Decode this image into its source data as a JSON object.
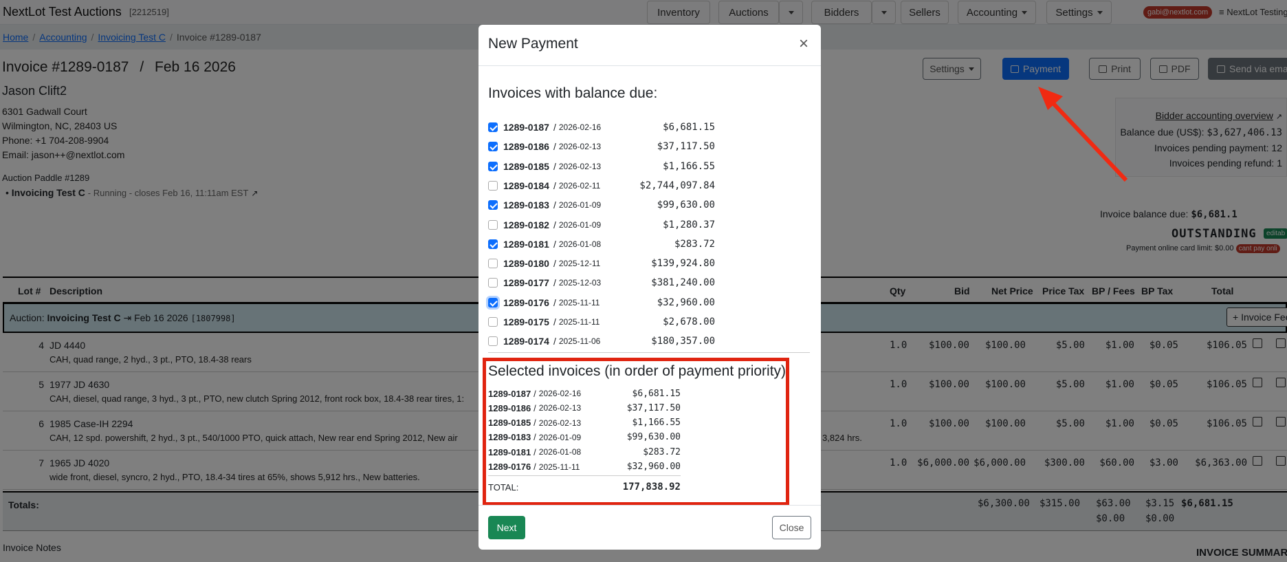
{
  "app": {
    "name": "NextLot Test Auctions",
    "id": "[2212519]"
  },
  "nav": {
    "inventory": "Inventory",
    "auctions": "Auctions",
    "bidders": "Bidders",
    "sellers": "Sellers",
    "accounting": "Accounting",
    "settings": "Settings",
    "user_email": "gabi@nextlot.com",
    "user_org": "≡ NextLot Testing"
  },
  "breadcrumb": {
    "home": "Home",
    "accounting": "Accounting",
    "invoicing": "Invoicing Test C",
    "current": "Invoice #1289-0187"
  },
  "invoice": {
    "number": "Invoice #1289-0187",
    "sep": "/",
    "date": "Feb 16 2026",
    "customer": "Jason Clift2",
    "addr1": "6301 Gadwall Court",
    "addr2": "Wilmington, NC, 28403 US",
    "phone": "Phone: +1 704-208-9904",
    "email": "Email: jason++@nextlot.com",
    "paddle": "Auction Paddle #1289",
    "auction_name": "Invoicing Test C",
    "auction_status": "- Running - closes Feb 16, 11:11am EST"
  },
  "actions": {
    "settings": "Settings",
    "payment": "Payment",
    "print": "Print",
    "pdf": "PDF",
    "send": "Send via email"
  },
  "accounting": {
    "overview": "Bidder accounting overview",
    "balance_label": "Balance due (US$):",
    "balance_value": "$3,627,406.13",
    "pending_payment_label": "Invoices pending payment:",
    "pending_payment_value": "12",
    "pending_refund_label": "Invoices pending refund:",
    "pending_refund_value": "1",
    "invoice_balance_label": "Invoice balance due:",
    "invoice_balance_value": "$6,681.1",
    "status": "OUTSTANDING",
    "editable": "editab",
    "card_limit": "Payment online card limit: $0.00",
    "cant_pay": "cant pay onli"
  },
  "table": {
    "headers": {
      "lot": "Lot #",
      "desc": "Description",
      "qty": "Qty",
      "bid": "Bid",
      "net": "Net Price",
      "ptax": "Price Tax",
      "bp": "BP / Fees",
      "bptax": "BP Tax",
      "total": "Total"
    },
    "auction_row": {
      "label": "Auction:",
      "name": "Invoicing Test C",
      "arrow": "⇥",
      "date": "Feb 16 2026",
      "id": "[1807998]",
      "fee_btn": "+ Invoice Fee"
    },
    "rows": [
      {
        "lot": "4",
        "title": "JD 4440",
        "desc": "CAH, quad range, 2 hyd., 3 pt., PTO, 18.4-38 rears",
        "qty": "1.0",
        "bid": "$100.00",
        "net": "$100.00",
        "ptax": "$5.00",
        "bp": "$1.00",
        "bptax": "$0.05",
        "total": "$106.05"
      },
      {
        "lot": "5",
        "title": "1977 JD 4630",
        "desc": "CAH, diesel, quad range, 3 hyd., 3 pt., PTO, new clutch Spring 2012, front rock box, 18.4-38 rear tires, 1:",
        "qty": "1.0",
        "bid": "$100.00",
        "net": "$100.00",
        "ptax": "$5.00",
        "bp": "$1.00",
        "bptax": "$0.05",
        "total": "$106.05"
      },
      {
        "lot": "6",
        "title": "1985 Case-IH 2294",
        "desc": "CAH, 12 spd. powershift, 2 hyd., 3 pt., 540/1000 PTO, quick attach, New rear end Spring 2012, New air",
        "desc2": "3,824 hrs.",
        "qty": "1.0",
        "bid": "$100.00",
        "net": "$100.00",
        "ptax": "$5.00",
        "bp": "$1.00",
        "bptax": "$0.05",
        "total": "$106.05"
      },
      {
        "lot": "7",
        "title": "1965 JD 4020",
        "desc": "wide front, diesel, syncro, 2 hyd., PTO, 18.4-34 tires at 65%, shows 5,912 hrs., New batteries.",
        "qty": "1.0",
        "bid": "$6,000.00",
        "net": "$6,000.00",
        "ptax": "$300.00",
        "bp": "$60.00",
        "bptax": "$3.00",
        "total": "$6,363.00"
      }
    ],
    "totals": {
      "label": "Totals:",
      "net": "$6,300.00",
      "ptax": "$315.00",
      "bp": "$63.00",
      "bp2": "$0.00",
      "bptax": "$3.15",
      "bptax2": "$0.00",
      "total": "$6,681.15"
    }
  },
  "notes_label": "Invoice Notes",
  "summary_label": "INVOICE SUMMARY",
  "modal": {
    "title": "New Payment",
    "close_x": "×",
    "subtitle": "Invoices with balance due:",
    "invoices": [
      {
        "num": "1289-0187",
        "date": "2026-02-16",
        "amt": "$6,681.15",
        "checked": true
      },
      {
        "num": "1289-0186",
        "date": "2026-02-13",
        "amt": "$37,117.50",
        "checked": true
      },
      {
        "num": "1289-0185",
        "date": "2026-02-13",
        "amt": "$1,166.55",
        "checked": true
      },
      {
        "num": "1289-0184",
        "date": "2026-02-11",
        "amt": "$2,744,097.84",
        "checked": false
      },
      {
        "num": "1289-0183",
        "date": "2026-01-09",
        "amt": "$99,630.00",
        "checked": true
      },
      {
        "num": "1289-0182",
        "date": "2026-01-09",
        "amt": "$1,280.37",
        "checked": false
      },
      {
        "num": "1289-0181",
        "date": "2026-01-08",
        "amt": "$283.72",
        "checked": true
      },
      {
        "num": "1289-0180",
        "date": "2025-12-11",
        "amt": "$139,924.80",
        "checked": false
      },
      {
        "num": "1289-0177",
        "date": "2025-12-03",
        "amt": "$381,240.00",
        "checked": false
      },
      {
        "num": "1289-0176",
        "date": "2025-11-11",
        "amt": "$32,960.00",
        "checked": true
      },
      {
        "num": "1289-0175",
        "date": "2025-11-11",
        "amt": "$2,678.00",
        "checked": false
      },
      {
        "num": "1289-0174",
        "date": "2025-11-06",
        "amt": "$180,357.00",
        "checked": false
      }
    ],
    "selected_title": "Selected invoices (in order of payment priority)",
    "selected": [
      {
        "num": "1289-0187",
        "date": "2026-02-16",
        "amt": "$6,681.15"
      },
      {
        "num": "1289-0186",
        "date": "2026-02-13",
        "amt": "$37,117.50"
      },
      {
        "num": "1289-0185",
        "date": "2026-02-13",
        "amt": "$1,166.55"
      },
      {
        "num": "1289-0183",
        "date": "2026-01-09",
        "amt": "$99,630.00"
      },
      {
        "num": "1289-0181",
        "date": "2026-01-08",
        "amt": "$283.72"
      },
      {
        "num": "1289-0176",
        "date": "2025-11-11",
        "amt": "$32,960.00"
      }
    ],
    "total_label": "TOTAL:",
    "total_value": "177,838.92",
    "next": "Next",
    "close": "Close"
  },
  "colors": {
    "primary": "#0d6efd",
    "success": "#198754",
    "highlight": "#e02410",
    "annotation_arrow": "#f02a12"
  }
}
